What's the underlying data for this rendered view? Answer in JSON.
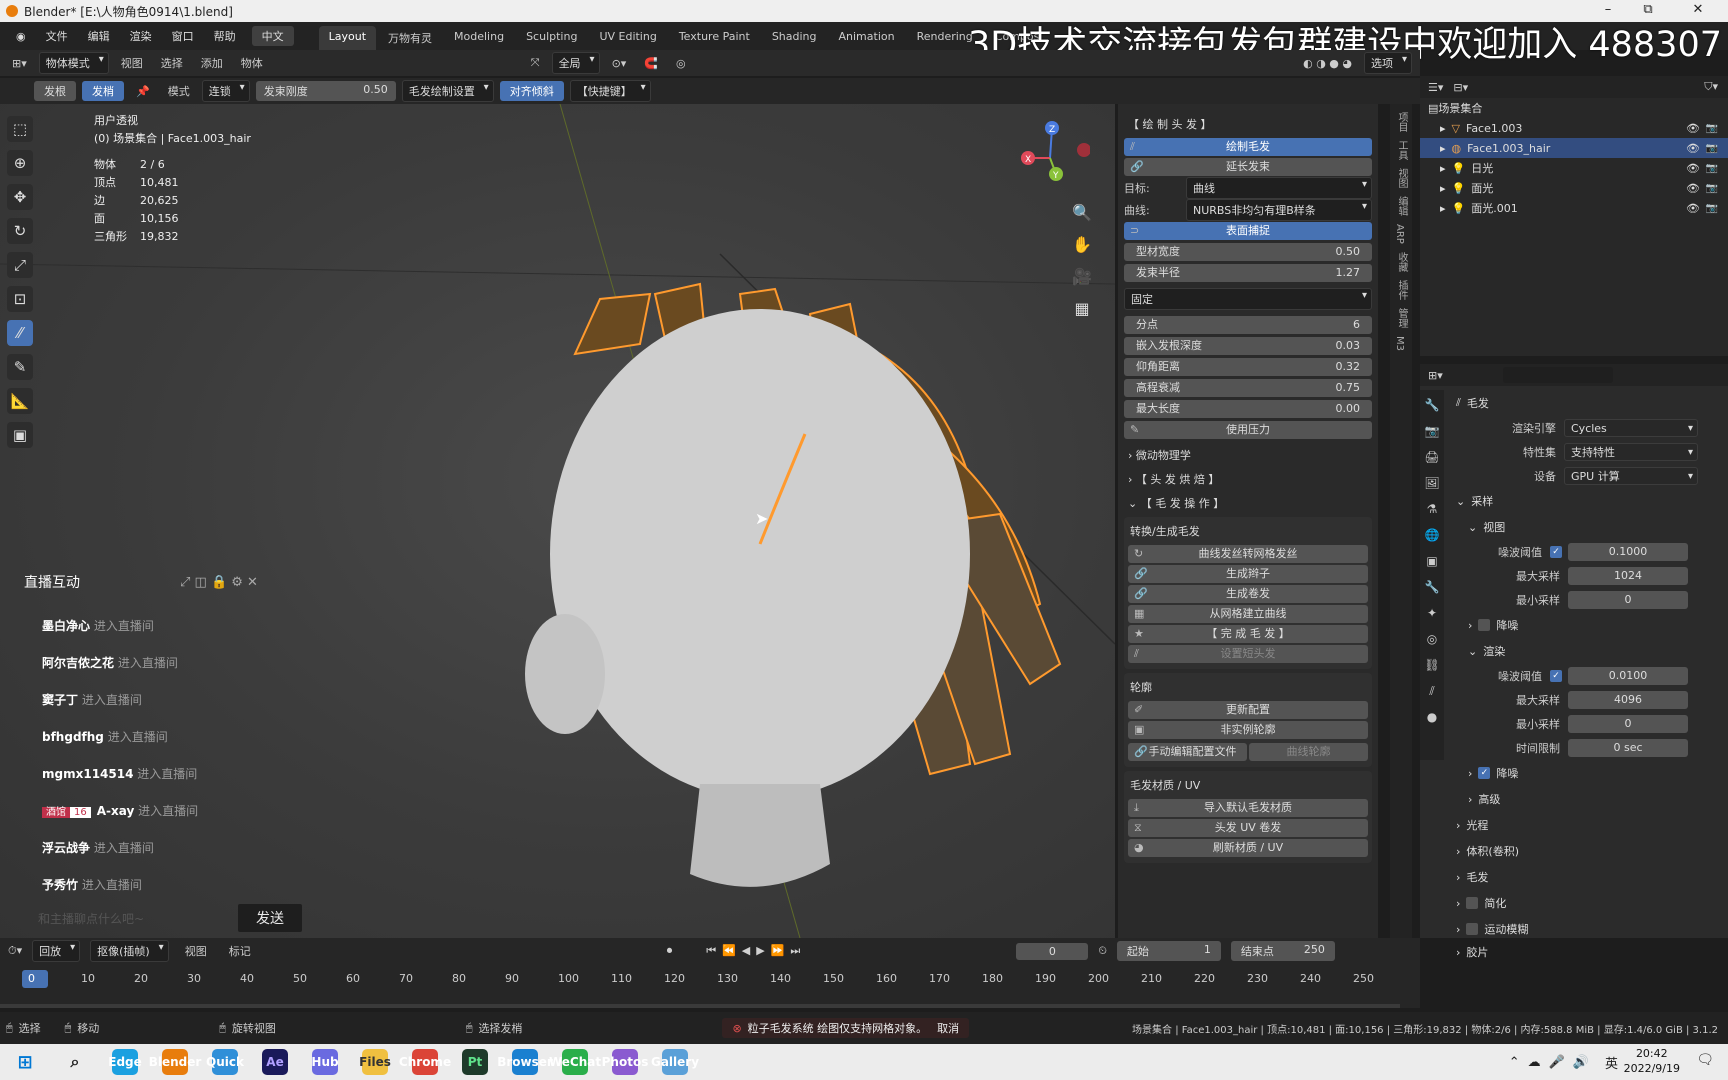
{
  "window": {
    "title": "Blender* [E:\\人物角色0914\\1.blend]",
    "min": "–",
    "max": "⧉",
    "close": "✕"
  },
  "overlay_text": "3D技术交流接包发包群建设中欢迎加入 488307",
  "menu": {
    "items": [
      "文件",
      "编辑",
      "渲染",
      "窗口",
      "帮助"
    ],
    "lang": "中文"
  },
  "workspaces": [
    "Layout",
    "万物有灵",
    "Modeling",
    "Sculpting",
    "UV Editing",
    "Texture Paint",
    "Shading",
    "Animation",
    "Rendering",
    "Composi"
  ],
  "header": {
    "mode": "物体模式",
    "menus": [
      "视图",
      "选择",
      "添加",
      "物体"
    ],
    "transform": "全局",
    "options": "选项"
  },
  "toolbar2": {
    "root": "发根",
    "tip": "发梢",
    "mode_label": "模式",
    "mode_value": "连锁",
    "stiffness_label": "发束刚度",
    "stiffness_value": "0.50",
    "draw_settings": "毛发绘制设置",
    "align": "对齐",
    "align2": "倾斜",
    "shortcut": "【快捷键】"
  },
  "viewport_info": {
    "view": "用户透视",
    "scene": "(0) 场景集合 | Face1.003_hair",
    "stats": [
      {
        "k": "物体",
        "v": "2 / 6"
      },
      {
        "k": "顶点",
        "v": "10,481"
      },
      {
        "k": "边",
        "v": "20,625"
      },
      {
        "k": "面",
        "v": "10,156"
      },
      {
        "k": "三角形",
        "v": "19,832"
      }
    ]
  },
  "gizmo": {
    "x": "X",
    "y": "Y",
    "z": "Z"
  },
  "chat": {
    "title": "直播互动",
    "items": [
      {
        "user": "墨白净心",
        "action": "进入直播间"
      },
      {
        "user": "阿尔吉侬之花",
        "action": "进入直播间"
      },
      {
        "user": "窦子丁",
        "action": "进入直播间"
      },
      {
        "user": "bfhgdfhg",
        "action": "进入直播间"
      },
      {
        "user": "mgmx114514",
        "action": "进入直播间"
      },
      {
        "user": "A-xay",
        "action": "进入直播间",
        "badge": "酒馆",
        "level": "16"
      },
      {
        "user": "浮云战争",
        "action": "进入直播间"
      },
      {
        "user": "予秀竹",
        "action": "进入直播间"
      }
    ],
    "send": "发送",
    "placeholder": "和主播聊点什么吧~"
  },
  "npanel": {
    "draw_header": "【 绘 制 头 发 】",
    "draw_hair": "绘制毛发",
    "extend": "延长发束",
    "target_label": "目标:",
    "target_value": "曲线",
    "curve_label": "曲线:",
    "curve_value": "NURBS非均匀有理B样条",
    "surface_snap": "表面捕捉",
    "fields1": [
      {
        "k": "型材宽度",
        "v": "0.50"
      },
      {
        "k": "发束半径",
        "v": "1.27"
      }
    ],
    "fixed": "固定",
    "fields2": [
      {
        "k": "分点",
        "v": "6"
      },
      {
        "k": "嵌入发根深度",
        "v": "0.03"
      },
      {
        "k": "仰角距离",
        "v": "0.32"
      },
      {
        "k": "高程衰减",
        "v": "0.75"
      },
      {
        "k": "最大长度",
        "v": "0.00"
      }
    ],
    "pressure": "使用压力",
    "physics": "微动物理学",
    "bake": "【 头 发 烘 焙 】",
    "ops": "【 毛 发 操 作 】",
    "convert_title": "转换/生成毛发",
    "convert_btns": [
      "曲线发丝转网格发丝",
      "生成辫子",
      "生成卷发",
      "从网格建立曲线",
      "【 完 成 毛 发 】",
      "设置短头发"
    ],
    "profile": "轮廓",
    "profile_btns": [
      "更新配置",
      "非实例轮廓",
      "手动编辑配置文件"
    ],
    "profile_extra": "曲线轮廓",
    "mat_title": "毛发材质 / UV",
    "mat_btns": [
      "导入默认毛发材质",
      "头发 UV 卷发",
      "刷新材质 / UV"
    ]
  },
  "side_tabs": [
    "项目",
    "工具",
    "视图",
    "编辑",
    "ARP",
    "收藏",
    "插件",
    "管理",
    "M3"
  ],
  "outliner": {
    "root": "场景集合",
    "rows": [
      {
        "name": "Face1.003",
        "sel": false
      },
      {
        "name": "Face1.003_hair",
        "sel": true
      },
      {
        "name": "日光",
        "sel": false
      },
      {
        "name": "面光",
        "sel": false
      },
      {
        "name": "面光.001",
        "sel": false
      }
    ]
  },
  "props": {
    "title": "毛发",
    "engine_label": "渲染引擎",
    "engine": "Cycles",
    "feature_label": "特性集",
    "feature": "支持特性",
    "device_label": "设备",
    "device": "GPU 计算",
    "sampling": "采样",
    "viewport": "视图",
    "vp_noise_label": "噪波阈值",
    "vp_noise": "0.1000",
    "vp_max_label": "最大采样",
    "vp_max": "1024",
    "vp_min_label": "最小采样",
    "vp_min": "0",
    "denoise": "降噪",
    "render": "渲染",
    "r_noise_label": "噪波阈值",
    "r_noise": "0.0100",
    "r_max_label": "最大采样",
    "r_max": "4096",
    "r_min_label": "最小采样",
    "r_min": "0",
    "time_label": "时间限制",
    "time": "0 sec",
    "r_denoise": "降噪",
    "advanced": "高级",
    "sections": [
      "光程",
      "体积(卷积)",
      "毛发",
      "简化",
      "运动模糊",
      "胶片"
    ]
  },
  "timeline": {
    "menus": [
      "回放",
      "抠像(插帧)",
      "视图",
      "标记"
    ],
    "current": "0",
    "start_label": "起始",
    "start": "1",
    "end_label": "结束点",
    "end": "250",
    "ticks": [
      "0",
      "10",
      "20",
      "30",
      "40",
      "50",
      "60",
      "70",
      "80",
      "90",
      "100",
      "110",
      "120",
      "130",
      "140",
      "150",
      "160",
      "170",
      "180",
      "190",
      "200",
      "210",
      "220",
      "230",
      "240",
      "250"
    ]
  },
  "status": {
    "select": "选择",
    "move": "移动",
    "rotate": "旋转视图",
    "select_hair": "选择发梢",
    "error": "粒子毛发系统 绘图仅支持网格对象。",
    "cancel": "取消",
    "info": "场景集合 | Face1.003_hair | 顶点:10,481 | 面:10,156 | 三角形:19,832 | 物体:2/6 | 内存:588.8 MiB | 显存:1.4/6.0 GiB | 3.1.2"
  },
  "taskbar": {
    "apps": [
      "Edge",
      "Blender",
      "Quick",
      "Ae",
      "Hub",
      "Files",
      "Chrome",
      "Pt",
      "Browser",
      "WeChat",
      "Photos",
      "Gallery"
    ],
    "ime": "英",
    "time": "20:42",
    "date": "2022/9/19"
  },
  "keyhint": "D"
}
